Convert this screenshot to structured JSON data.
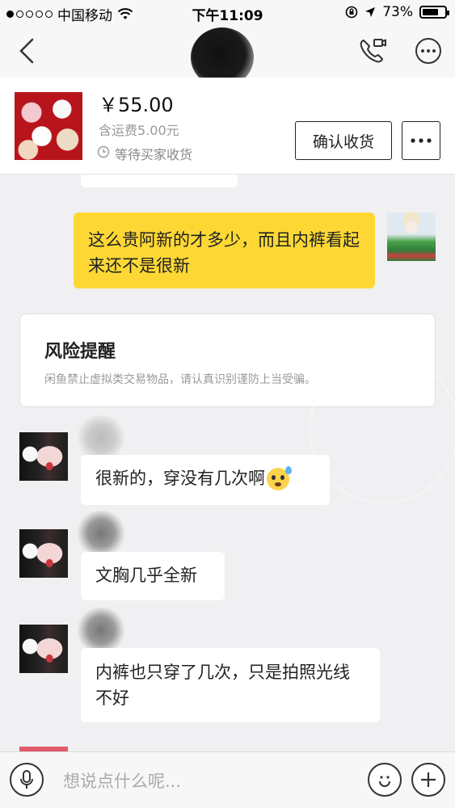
{
  "status_bar": {
    "carrier": "中国移动",
    "time": "下午11:09",
    "battery": "73%",
    "battery_level": 0.73
  },
  "nav": {
    "back_icon": "chevron-left-icon",
    "call_icon": "phone-video-icon",
    "more_icon": "ellipsis-circle-icon"
  },
  "product": {
    "price": "￥55.00",
    "shipping": "含运费5.00元",
    "status": "等待买家收货",
    "confirm_button": "确认收货",
    "more_button": "•••"
  },
  "messages": [
    {
      "sender": "me",
      "text": "这么贵阿新的才多少，而且内裤看起来还不是很新"
    },
    {
      "sender": "system",
      "title": "风险提醒",
      "text": "闲鱼禁止虚拟类交易物品，请认真识别谨防上当受骗。"
    },
    {
      "sender": "other",
      "text": "很新的，穿没有几次啊"
    },
    {
      "sender": "other",
      "text": "文胸几乎全新"
    },
    {
      "sender": "other",
      "text": "内裤也只穿了几次，只是拍照光线不好"
    }
  ],
  "input": {
    "placeholder": "想说点什么呢..."
  }
}
